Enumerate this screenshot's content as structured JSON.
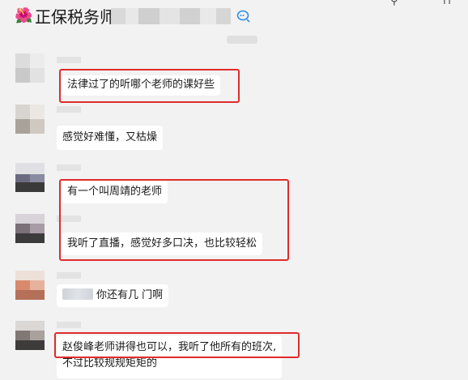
{
  "header": {
    "emoji": "🌺",
    "title": "正保税务师",
    "pin_glyph": "⚲",
    "restore_glyph": "⊓"
  },
  "messages": [
    {
      "text": "法律过了的听哪个老师的课好些"
    },
    {
      "text": "感觉好难懂，又枯燥"
    },
    {
      "text": "有一个叫周靖的老师"
    },
    {
      "text": "我听了直播，感觉好多口决，也比较轻松"
    },
    {
      "text": "你还有几 门啊"
    },
    {
      "line1": "赵俊峰老师讲得也可以，我听了他所有的班次,",
      "line2": "不过比较规规矩矩的"
    }
  ],
  "colors": {
    "highlight": "#e12b2b",
    "bubble": "#ffffff",
    "background": "#f2f2f2"
  }
}
